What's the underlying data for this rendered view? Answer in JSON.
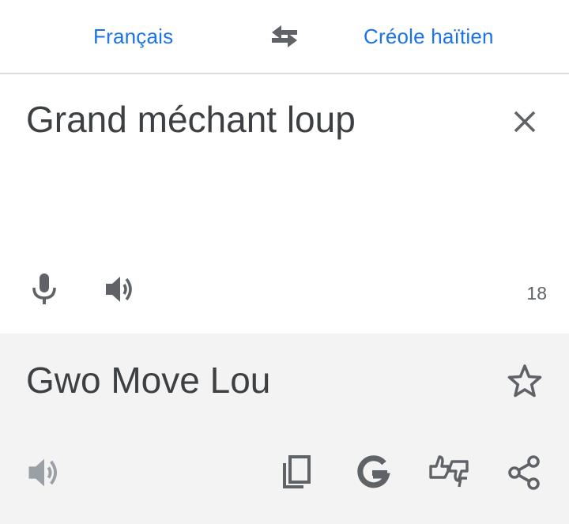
{
  "languages": {
    "source": "Français",
    "target": "Créole haïtien"
  },
  "input": {
    "text": "Grand méchant loup",
    "char_count": "18"
  },
  "output": {
    "text": "Gwo Move Lou"
  },
  "icons": {
    "swap": "swap-arrows-icon",
    "clear": "close-icon",
    "mic": "microphone-icon",
    "speak_source": "volume-icon",
    "star": "star-outline-icon",
    "speak_target": "volume-icon",
    "copy": "copy-icon",
    "google": "google-g-icon",
    "feedback": "thumbs-feedback-icon",
    "share": "share-icon"
  },
  "colors": {
    "accent": "#1a73e8",
    "icon": "#5f6368",
    "text": "#3c4043",
    "disabled_icon": "#9aa0a6",
    "output_bg": "#f3f3f3"
  }
}
